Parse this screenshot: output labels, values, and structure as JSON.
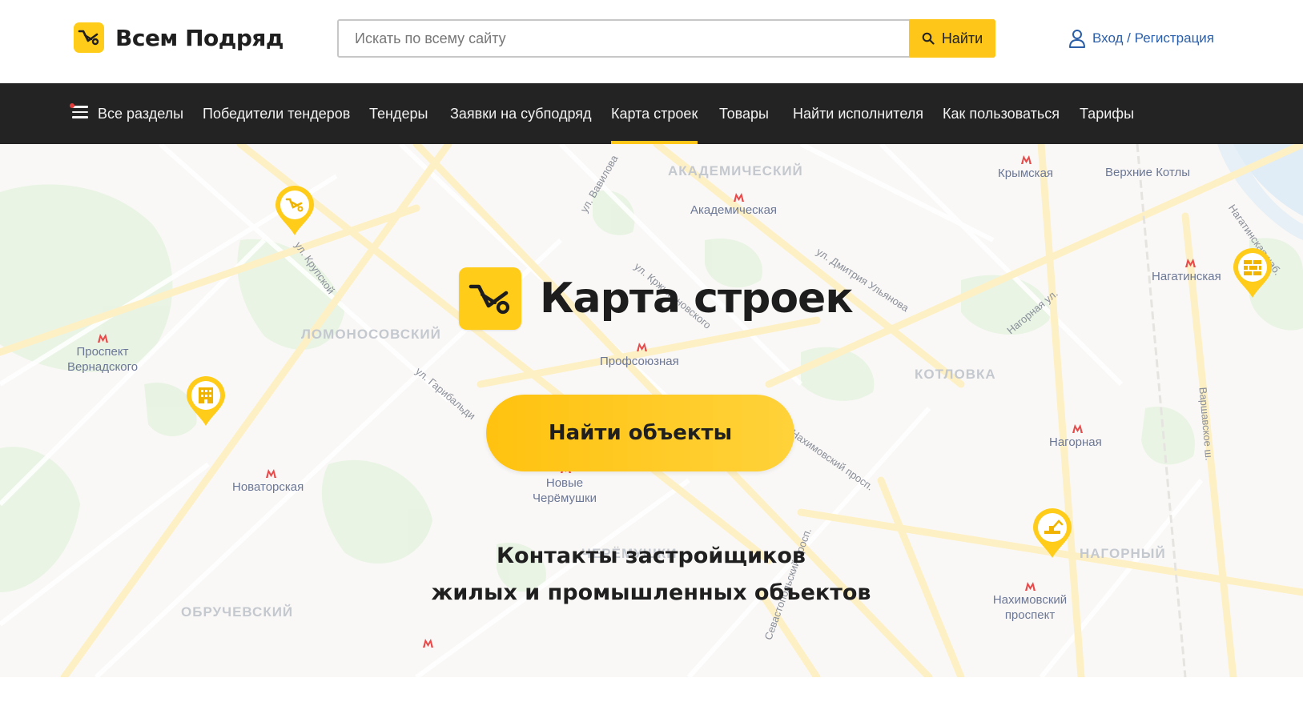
{
  "header": {
    "logo_text": "Всем Подряд",
    "search_placeholder": "Искать по всему сайту",
    "search_button": "Найти",
    "login": "Вход / Регистрация"
  },
  "nav": {
    "items": [
      {
        "label": "Все разделы",
        "active": false
      },
      {
        "label": "Победители тендеров",
        "active": false
      },
      {
        "label": "Тендеры",
        "active": false
      },
      {
        "label": "Заявки на субподряд",
        "active": false
      },
      {
        "label": "Карта строек",
        "active": true
      },
      {
        "label": "Товары",
        "active": false
      },
      {
        "label": "Найти исполнителя",
        "active": false
      },
      {
        "label": "Как пользоваться",
        "active": false
      },
      {
        "label": "Тарифы",
        "active": false
      }
    ]
  },
  "hero": {
    "title": "Карта строек",
    "button": "Найти объекты",
    "subtitle_line1": "Контакты застройщиков",
    "subtitle_line2": "жилых и промышленных объектов"
  },
  "map": {
    "districts": [
      "АКАДЕМИЧЕСКИЙ",
      "ЛОМОНОСОВСКИЙ",
      "КОТЛОВКА",
      "ЧЕРЁМУШКИ",
      "НАГОРНЫЙ",
      "ОБРУЧЕВСКИЙ"
    ],
    "stations": [
      "Академическая",
      "Крымская",
      "Верхние Котлы",
      "Нагатинская",
      "Профсоюзная",
      "Проспект Вернадского",
      "Нагорная",
      "Новаторская",
      "Новые Черёмушки",
      "Нахимовский проспект"
    ],
    "streets": [
      "ул. Вавилова",
      "ул. Крупской",
      "ул. Дмитрия Ульянова",
      "Нагорная ул.",
      "ул. Гарибальди",
      "Нахимовский просп.",
      "Севастопольский просп.",
      "Варшавское ш.",
      "Нагатинская наб.",
      "ул. Кржижановского"
    ],
    "pins": [
      "cart-pin",
      "building-pin",
      "bricks-pin",
      "excavator-pin"
    ]
  }
}
